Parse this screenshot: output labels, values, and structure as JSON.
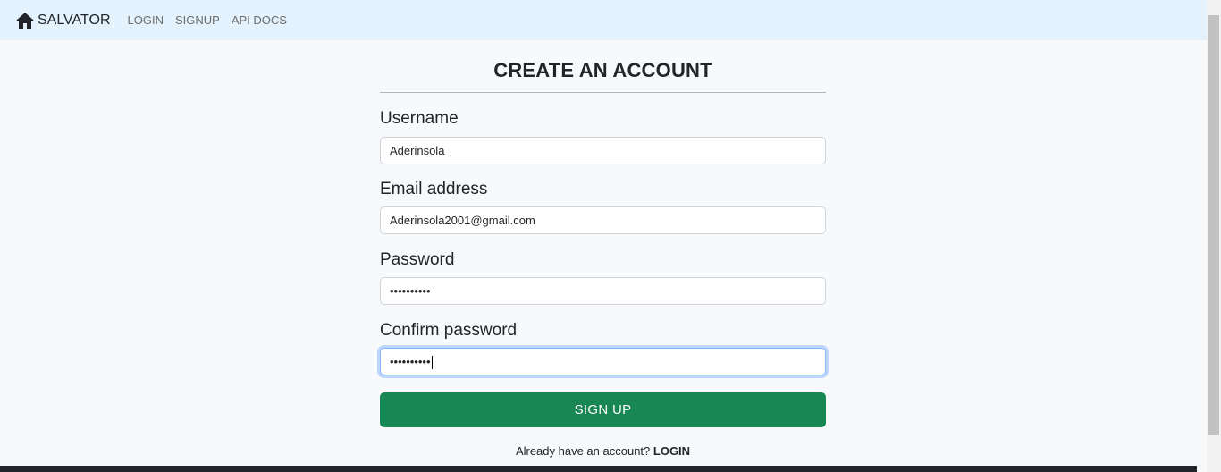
{
  "nav": {
    "brand": "SALVATOR",
    "links": [
      "LOGIN",
      "SIGNUP",
      "API DOCS"
    ]
  },
  "form": {
    "title": "CREATE AN ACCOUNT",
    "username": {
      "label": "Username",
      "value": "Aderinsola"
    },
    "email": {
      "label": "Email address",
      "value": "Aderinsola2001@gmail.com"
    },
    "password": {
      "label": "Password",
      "value": "••••••••••"
    },
    "confirm": {
      "label": "Confirm password",
      "value": "••••••••••"
    },
    "submit_label": "SIGN UP",
    "footer_text": "Already have an account?",
    "footer_link": "LOGIN"
  },
  "colors": {
    "navbar_bg": "#e3f2fd",
    "button_bg": "#198754",
    "focus_border": "#86b7fe"
  },
  "icons": {
    "brand": "home-icon"
  }
}
